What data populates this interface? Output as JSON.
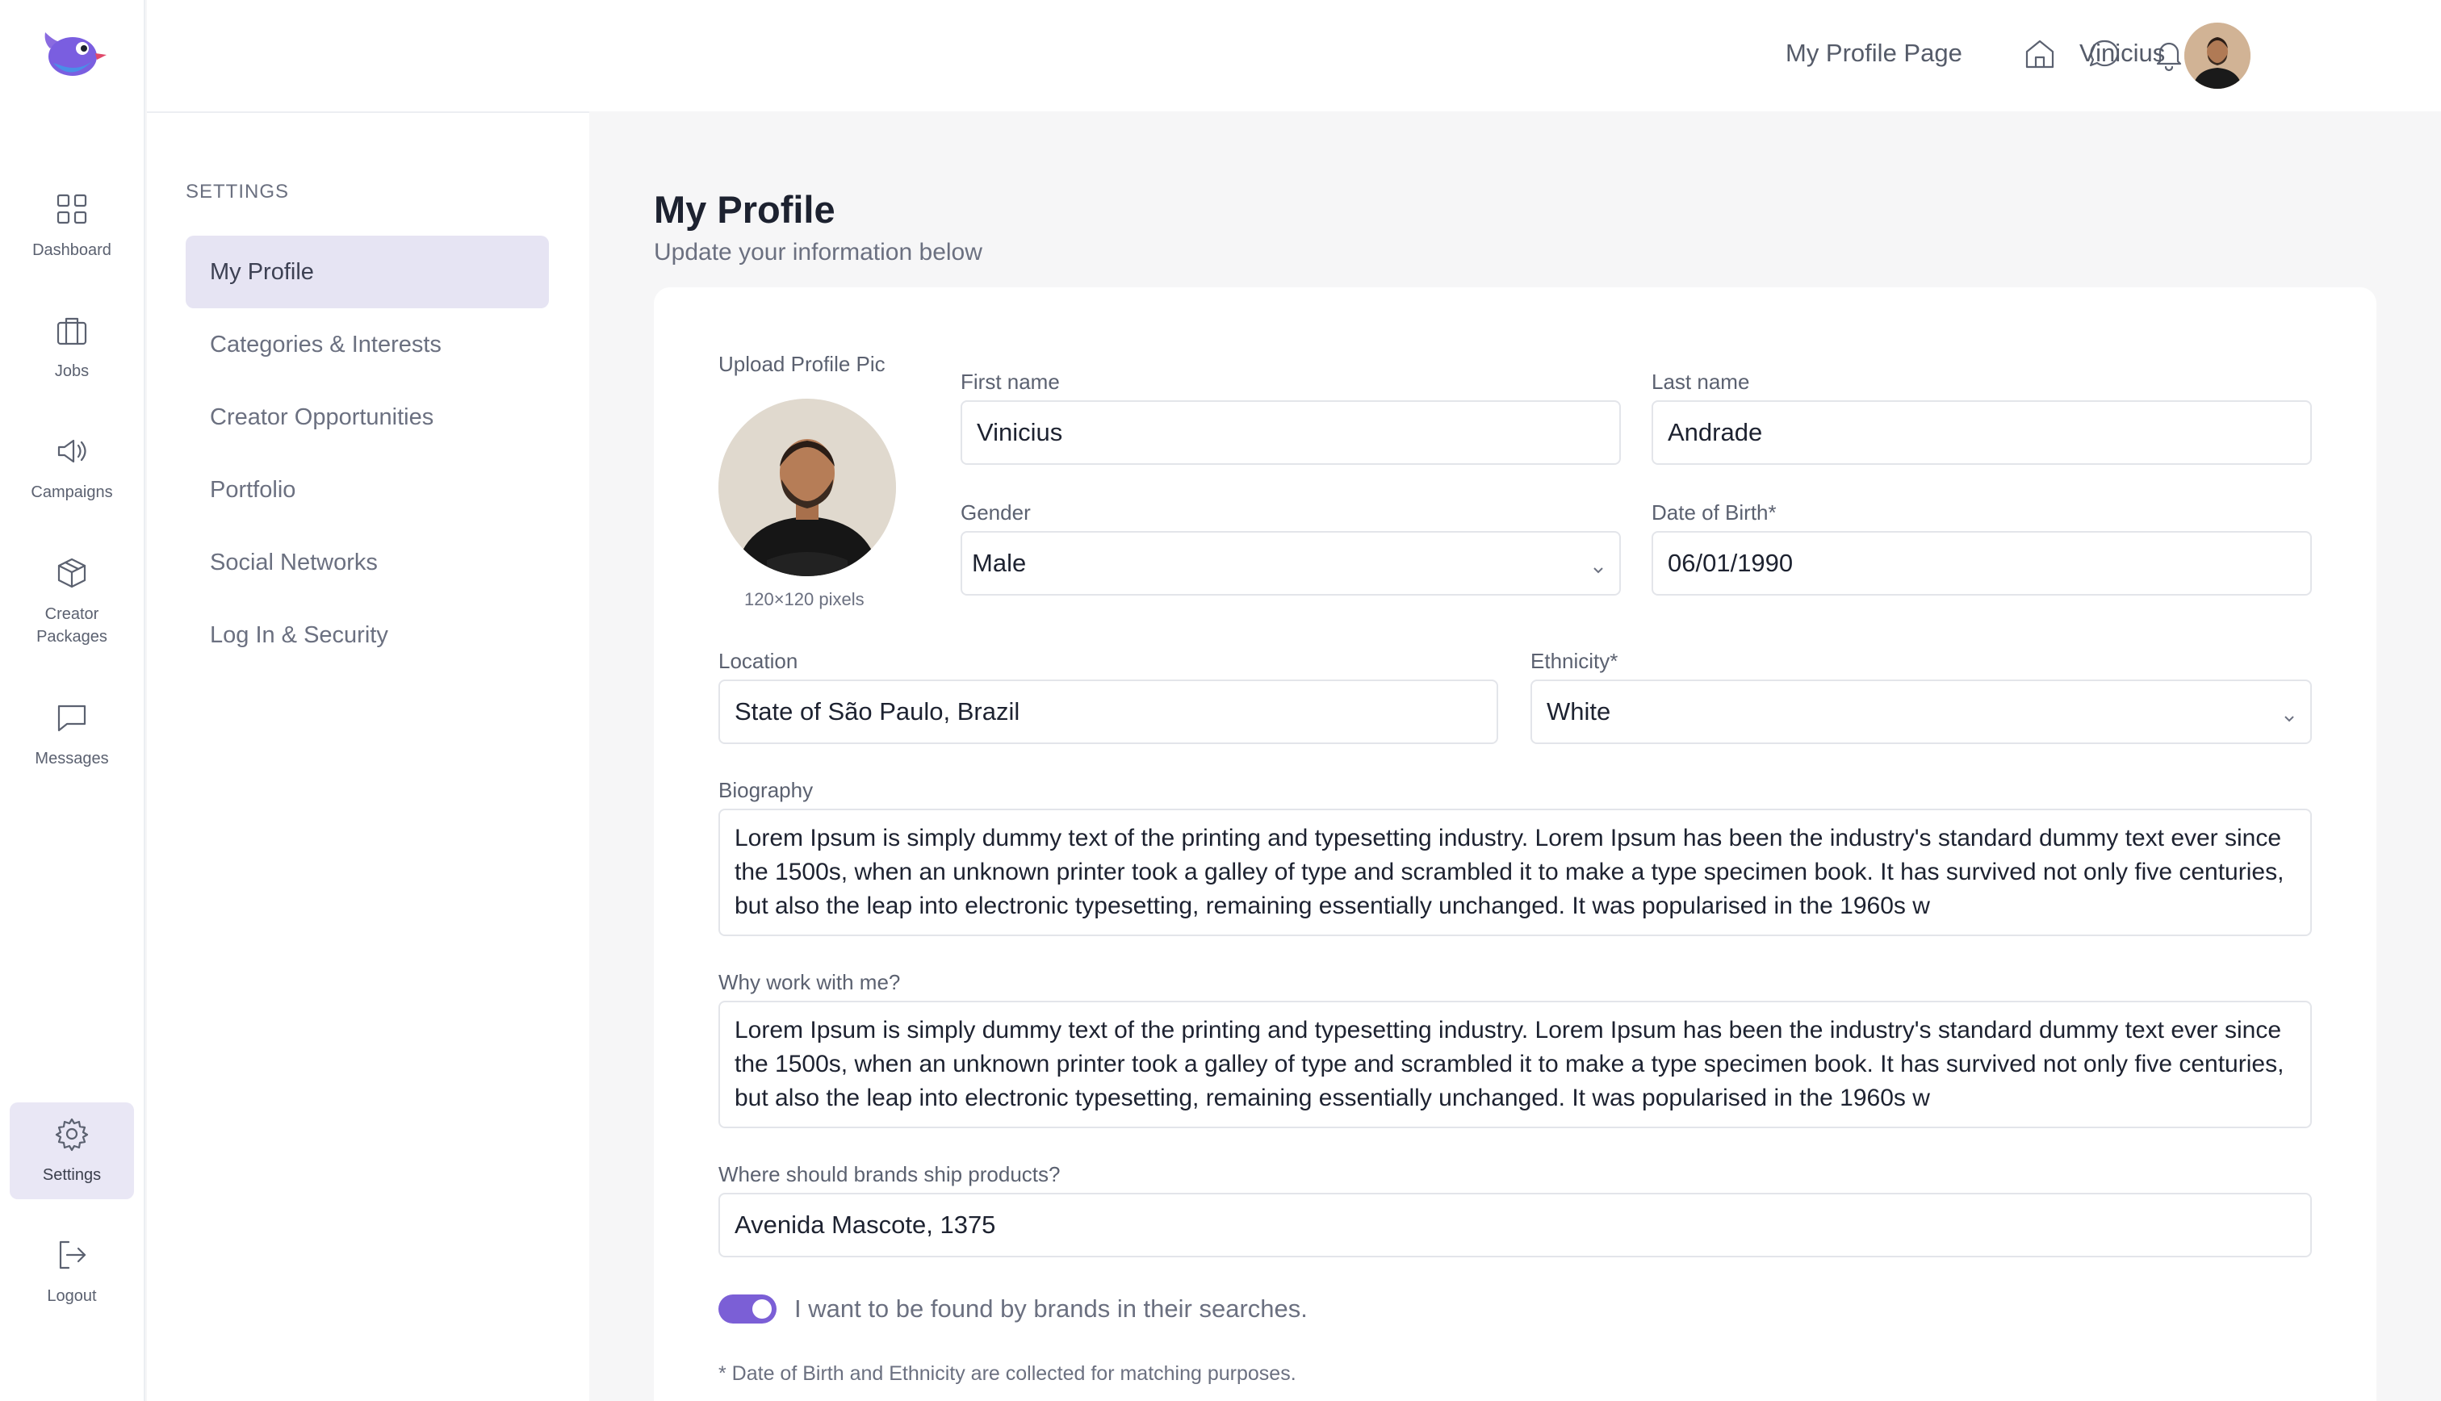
{
  "rail": {
    "items": [
      {
        "label": "Dashboard",
        "icon": "grid-icon"
      },
      {
        "label": "Jobs",
        "icon": "briefcase-icon"
      },
      {
        "label": "Campaigns",
        "icon": "megaphone-icon"
      },
      {
        "label": "Creator Packages",
        "icon": "package-icon"
      },
      {
        "label": "Messages",
        "icon": "message-icon"
      },
      {
        "label": "Settings",
        "icon": "gear-icon"
      },
      {
        "label": "Logout",
        "icon": "logout-icon"
      }
    ],
    "active": "Settings"
  },
  "panel": {
    "title": "SETTINGS",
    "items": [
      {
        "label": "My Profile"
      },
      {
        "label": "Categories & Interests"
      },
      {
        "label": "Creator Opportunities"
      },
      {
        "label": "Portfolio"
      },
      {
        "label": "Social Networks"
      },
      {
        "label": "Log In & Security"
      }
    ],
    "active": "My Profile"
  },
  "topbar": {
    "link": "My Profile Page",
    "user_name": "Vinicius"
  },
  "page": {
    "title": "My Profile",
    "subtitle": "Update your information below"
  },
  "form": {
    "upload_label": "Upload Profile Pic",
    "upload_note": "120×120 pixels",
    "first_name_label": "First name",
    "first_name": "Vinicius",
    "last_name_label": "Last name",
    "last_name": "Andrade",
    "gender_label": "Gender",
    "gender": "Male",
    "dob_label": "Date of Birth*",
    "dob": "06/01/1990",
    "location_label": "Location",
    "location": "State of São Paulo, Brazil",
    "ethnicity_label": "Ethnicity*",
    "ethnicity": "White",
    "bio_label": "Biography",
    "bio": "Lorem Ipsum is simply dummy text of the printing and typesetting industry. Lorem Ipsum has been the industry's standard dummy text ever since the 1500s, when an unknown printer took a galley of type and scrambled it to make a type specimen book. It has survived not only five centuries, but also the leap into electronic typesetting, remaining essentially unchanged. It was popularised in the 1960s w",
    "why_label": "Why work with me?",
    "why": "Lorem Ipsum is simply dummy text of the printing and typesetting industry. Lorem Ipsum has been the industry's standard dummy text ever since the 1500s, when an unknown printer took a galley of type and scrambled it to make a type specimen book. It has survived not only five centuries, but also the leap into electronic typesetting, remaining essentially unchanged. It was popularised in the 1960s w",
    "ship_label": "Where should brands ship products?",
    "ship": "Avenida Mascote, 1375",
    "toggle_label": "I want to be found by brands in their searches.",
    "toggle_on": true,
    "footnote": "* Date of Birth and Ethnicity are collected for matching purposes."
  },
  "colors": {
    "accent": "#7b5fd6",
    "active_bg": "#e6e4f3",
    "page_bg": "#f6f6f7"
  }
}
